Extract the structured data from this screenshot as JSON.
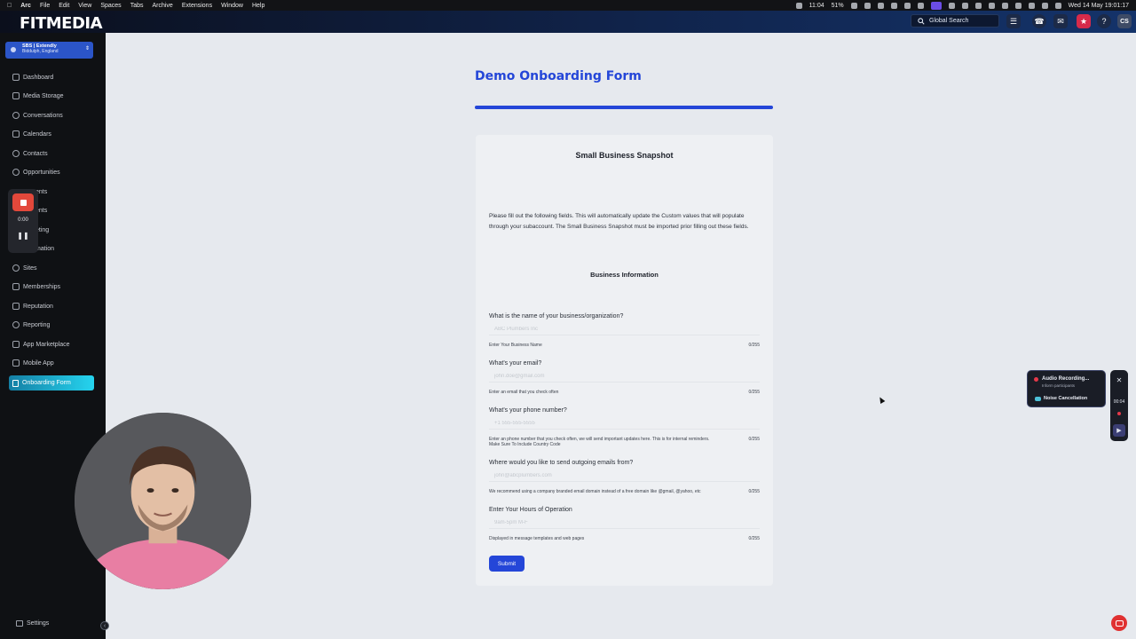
{
  "menubar": {
    "app": "Arc",
    "items": [
      "File",
      "Edit",
      "View",
      "Spaces",
      "Tabs",
      "Archive",
      "Extensions",
      "Window",
      "Help"
    ],
    "clock_left": "11:04",
    "battery": "51%",
    "datetime": "Wed 14 May 19:01:17"
  },
  "header": {
    "logo": "FITMEDIA",
    "search_label": "Global Search",
    "avatar_initials": "CS"
  },
  "sidebar": {
    "account_name": "SBS | Extendly",
    "account_location": "Biddulph, England",
    "items": [
      {
        "label": "Dashboard",
        "icon": "dashboard-icon"
      },
      {
        "label": "Media Storage",
        "icon": "media-icon"
      },
      {
        "label": "Conversations",
        "icon": "chat-icon"
      },
      {
        "label": "Calendars",
        "icon": "calendar-icon"
      },
      {
        "label": "Contacts",
        "icon": "contacts-icon"
      },
      {
        "label": "Opportunities",
        "icon": "opportunities-icon"
      },
      {
        "label": "ents",
        "icon": "payments-icon"
      },
      {
        "label": "ents",
        "icon": "ai-agents-icon"
      },
      {
        "label": "eting",
        "icon": "marketing-icon"
      },
      {
        "label": "mation",
        "icon": "automation-icon"
      },
      {
        "label": "Sites",
        "icon": "globe-icon"
      },
      {
        "label": "Memberships",
        "icon": "memberships-icon"
      },
      {
        "label": "Reputation",
        "icon": "reputation-icon"
      },
      {
        "label": "Reporting",
        "icon": "reporting-icon"
      },
      {
        "label": "App Marketplace",
        "icon": "marketplace-icon"
      },
      {
        "label": "Mobile App",
        "icon": "mobile-icon"
      }
    ],
    "active_item": "Onboarding Form",
    "settings": "Settings"
  },
  "recorder": {
    "time": "0:00"
  },
  "form": {
    "page_title": "Demo Onboarding Form",
    "card_title": "Small Business Snapshot",
    "intro": "Please fill out the following fields. This will automatically update the Custom values that will populate through your subaccount. The Small Business Snapshot must be imported prior filling out these fields.",
    "section": "Business Information",
    "fields": [
      {
        "label": "What is the name of your business/organization?",
        "placeholder": "ABC Plumbers Inc",
        "help": "Enter Your Business Name",
        "count": "0/255"
      },
      {
        "label": "What's your email?",
        "placeholder": "john.doe@gmail.com",
        "help": "Enter an email that you check often",
        "count": "0/255"
      },
      {
        "label": "What's your phone number?",
        "placeholder": "+1 555-555-5555",
        "help": "Enter an phone number that you check often, we will send important updates here. This is for internal reminders. Make Sure To Include Country Code",
        "count": "0/255"
      },
      {
        "label": "Where would you like to send outgoing emails from?",
        "placeholder": "john@abcplumbers.com",
        "help": "We recommend using a company branded email domain instead of a free domain like @gmail, @yahoo, etc",
        "count": "0/255"
      },
      {
        "label": "Enter Your Hours of Operation",
        "placeholder": "9am-5pm M-F",
        "help": "Displayed in message templates and web pages",
        "count": "0/255"
      }
    ],
    "submit": "Submit"
  },
  "audio_panel": {
    "title": "Audio Recording...",
    "subtitle": "Inform participants",
    "noise": "Noise Cancellation",
    "time": "00:04"
  },
  "colors": {
    "accent": "#2446d8",
    "sidebar_bg": "#0f1114",
    "active_nav": "#25d4ef",
    "record_red": "#e3483b"
  }
}
